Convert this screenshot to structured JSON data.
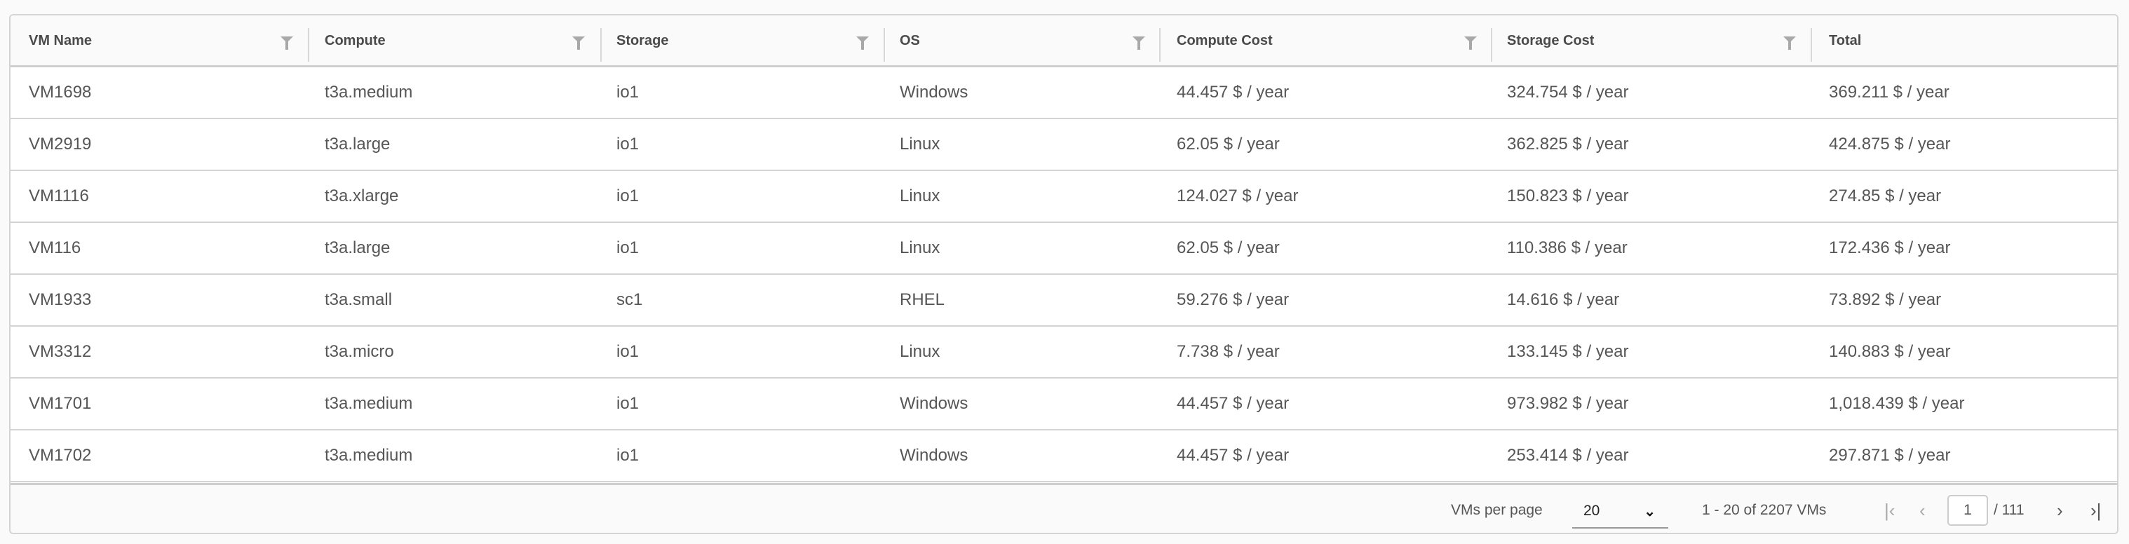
{
  "columns": [
    "VM Name",
    "Compute",
    "Storage",
    "OS",
    "Compute Cost",
    "Storage Cost",
    "Total"
  ],
  "rows": [
    [
      "VM1698",
      "t3a.medium",
      "io1",
      "Windows",
      "44.457 $ / year",
      "324.754 $ / year",
      "369.211 $ / year"
    ],
    [
      "VM2919",
      "t3a.large",
      "io1",
      "Linux",
      "62.05 $ / year",
      "362.825 $ / year",
      "424.875 $ / year"
    ],
    [
      "VM1116",
      "t3a.xlarge",
      "io1",
      "Linux",
      "124.027 $ / year",
      "150.823 $ / year",
      "274.85 $ / year"
    ],
    [
      "VM116",
      "t3a.large",
      "io1",
      "Linux",
      "62.05 $ / year",
      "110.386 $ / year",
      "172.436 $ / year"
    ],
    [
      "VM1933",
      "t3a.small",
      "sc1",
      "RHEL",
      "59.276 $ / year",
      "14.616 $ / year",
      "73.892 $ / year"
    ],
    [
      "VM3312",
      "t3a.micro",
      "io1",
      "Linux",
      "7.738 $ / year",
      "133.145 $ / year",
      "140.883 $ / year"
    ],
    [
      "VM1701",
      "t3a.medium",
      "io1",
      "Windows",
      "44.457 $ / year",
      "973.982 $ / year",
      "1,018.439 $ / year"
    ],
    [
      "VM1702",
      "t3a.medium",
      "io1",
      "Windows",
      "44.457 $ / year",
      "253.414 $ / year",
      "297.871 $ / year"
    ]
  ],
  "footer": {
    "per_page_label": "VMs per page",
    "per_page_value": "20",
    "range_text": "1 - 20 of 2207 VMs",
    "current_page": "1",
    "total_pages": "/ 111"
  },
  "icons": {
    "filter": "filter-icon",
    "first": "first-page-icon",
    "prev": "prev-page-icon",
    "next": "next-page-icon",
    "last": "last-page-icon",
    "dropdown": "chevron-down-icon"
  }
}
